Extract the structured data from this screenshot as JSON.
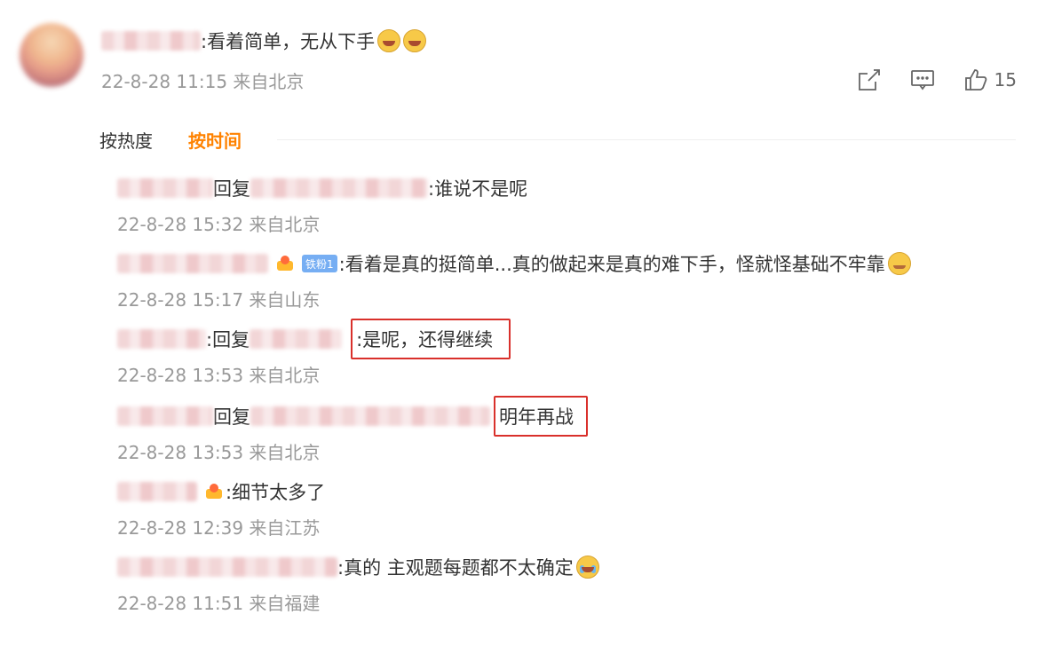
{
  "post": {
    "main_text": ":看着简单，无从下手",
    "meta": "22-8-28 11:15 来自北京",
    "actions": {
      "share_icon": "share-icon",
      "comment_icon": "comment-icon",
      "like_icon": "thumbs-up-icon",
      "like_count": "15"
    }
  },
  "tabs": [
    "按热度",
    "按时间"
  ],
  "replies": [
    {
      "reply_word": "回复",
      "text": ":谁说不是呢",
      "meta": "22-8-28 15:32 来自北京"
    },
    {
      "badge": "铁粉1",
      "text": ":看着是真的挺简单...真的做起来是真的难下手，怪就怪基础不牢靠",
      "meta": "22-8-28 15:17 来自山东"
    },
    {
      "reply_word": ":回复",
      "text": ":是呢，还得继续",
      "meta": "22-8-28 13:53 来自北京"
    },
    {
      "reply_word": "回复",
      "text": "明年再战",
      "meta": "22-8-28 13:53 来自北京"
    },
    {
      "text": ":细节太多了",
      "meta": "22-8-28 12:39 来自江苏"
    },
    {
      "text": ":真的 主观题每题都不太确定",
      "meta": "22-8-28 11:51 来自福建"
    }
  ],
  "colors": {
    "accent": "#ff8200",
    "meta": "#999999",
    "highlight_border": "#d9302b"
  }
}
